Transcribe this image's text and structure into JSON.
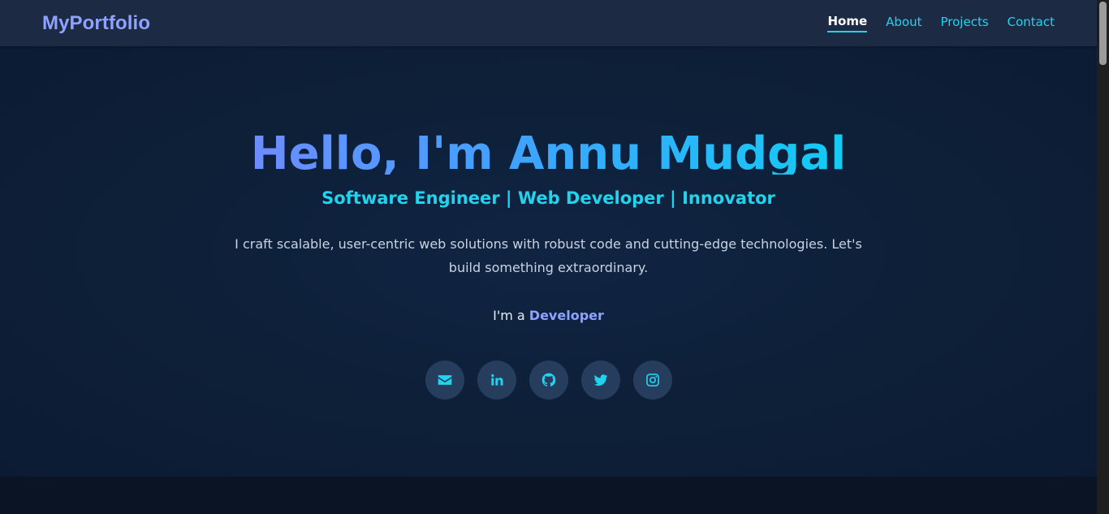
{
  "nav": {
    "brand": "MyPortfolio",
    "links": [
      "Home",
      "About",
      "Projects",
      "Contact"
    ],
    "active": "Home"
  },
  "hero": {
    "title": "Hello, I'm Annu Mudgal",
    "subtitle": "Software Engineer | Web Developer | Innovator",
    "description": "I craft scalable, user-centric web solutions with robust code and cutting-edge technologies. Let's build something extraordinary.",
    "typing_prefix": "I'm a",
    "typing_role": "Developer"
  },
  "socials": [
    {
      "icon": "envelope-icon"
    },
    {
      "icon": "linkedin-icon"
    },
    {
      "icon": "github-icon"
    },
    {
      "icon": "twitter-icon"
    },
    {
      "icon": "instagram-icon"
    }
  ],
  "colors": {
    "accent": "#22d3ee",
    "brand": "#8ea2ff",
    "nav_bg": "#1c2a44",
    "hero_bg": "#0e2039",
    "social_bg": "#263d5d"
  }
}
